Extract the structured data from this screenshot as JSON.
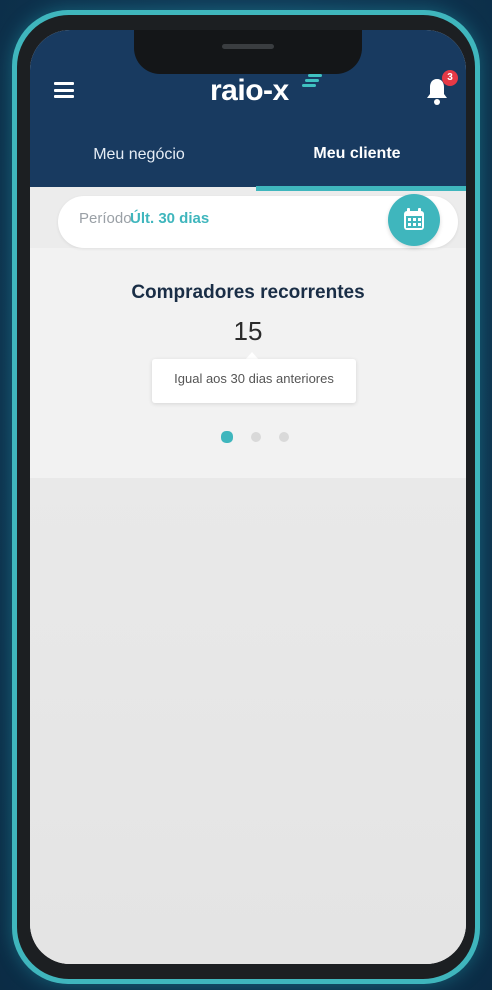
{
  "app": {
    "logo_text": "raio-x",
    "notification_count": "3"
  },
  "tabs": [
    {
      "label": "Meu negócio",
      "active": false
    },
    {
      "label": "Meu cliente",
      "active": true
    }
  ],
  "period": {
    "label": "Período",
    "value": "Últ. 30 dias"
  },
  "metric": {
    "title": "Compradores recorrentes",
    "value": "15",
    "comparison": "Igual aos 30 dias anteriores"
  },
  "carousel": {
    "pages": 3,
    "active_index": 0
  },
  "colors": {
    "header": "#183a60",
    "accent": "#3fb6bd",
    "badge": "#e63946"
  },
  "icons": [
    "menu-icon",
    "bell-icon",
    "calendar-icon"
  ]
}
